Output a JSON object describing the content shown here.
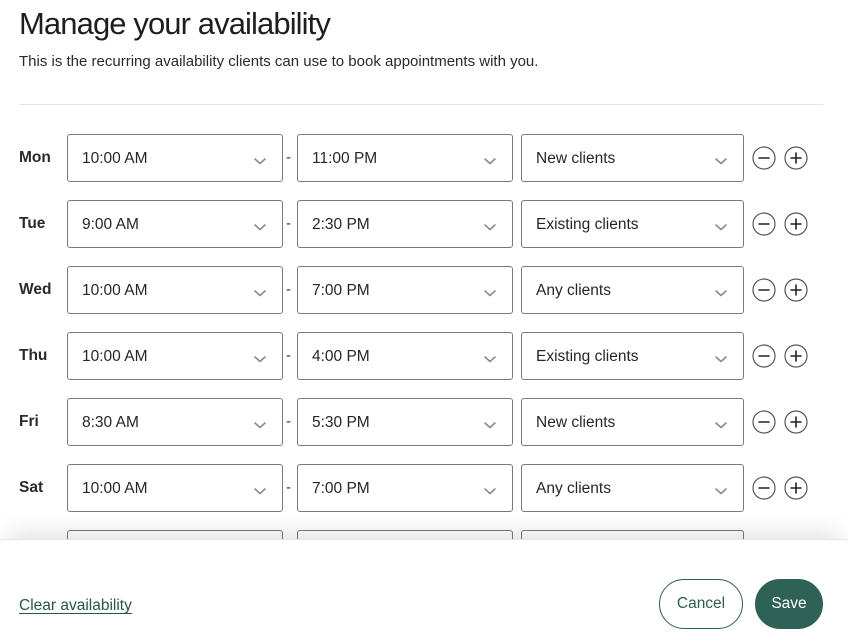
{
  "header": {
    "title": "Manage your availability",
    "subtitle": "This is the recurring availability clients can use to book appointments with you."
  },
  "schedule": [
    {
      "day": "Mon",
      "start": "10:00 AM",
      "end": "11:00 PM",
      "clients": "New clients"
    },
    {
      "day": "Tue",
      "start": "9:00 AM",
      "end": "2:30 PM",
      "clients": "Existing clients"
    },
    {
      "day": "Wed",
      "start": "10:00 AM",
      "end": "7:00 PM",
      "clients": "Any clients"
    },
    {
      "day": "Thu",
      "start": "10:00 AM",
      "end": "4:00 PM",
      "clients": "Existing clients"
    },
    {
      "day": "Fri",
      "start": "8:30 AM",
      "end": "5:30 PM",
      "clients": "New clients"
    },
    {
      "day": "Sat",
      "start": "10:00 AM",
      "end": "7:00 PM",
      "clients": "Any clients"
    },
    {
      "day": "",
      "start": "",
      "end": "",
      "clients": ""
    }
  ],
  "separator": "-",
  "footer": {
    "clear_label": "Clear availability",
    "cancel_label": "Cancel",
    "save_label": "Save"
  },
  "icons": {
    "dropdown": "chevron-down-icon",
    "remove": "minus-circle-icon",
    "add": "plus-circle-icon"
  },
  "colors": {
    "accent": "#2f6257",
    "link": "#25574c",
    "border": "#7a7a7a"
  }
}
